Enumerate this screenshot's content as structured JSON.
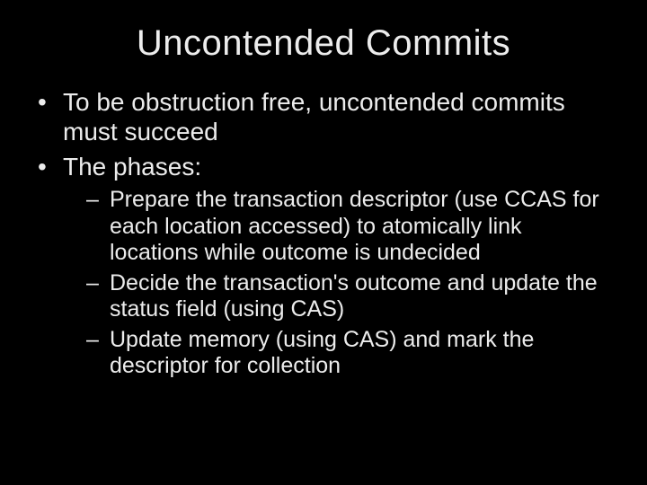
{
  "slide": {
    "title": "Uncontended Commits",
    "bullets": [
      {
        "text": "To be obstruction free, uncontended commits must succeed"
      },
      {
        "text": "The phases:"
      }
    ],
    "subbullets": [
      {
        "text": "Prepare the transaction descriptor (use CCAS for each location accessed) to atomically link locations while outcome is undecided"
      },
      {
        "text": "Decide the transaction's outcome and update the status field (using CAS)"
      },
      {
        "text": "Update memory (using CAS) and mark the descriptor for collection"
      }
    ]
  }
}
